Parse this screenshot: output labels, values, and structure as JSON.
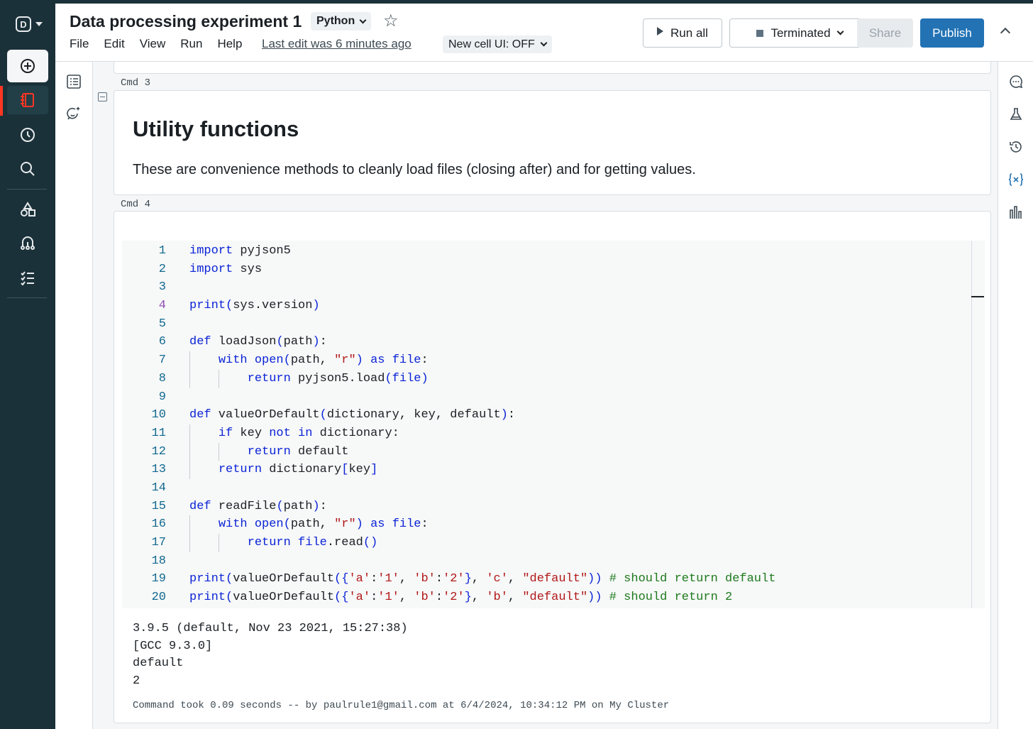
{
  "notebook": {
    "title": "Data processing experiment 1",
    "language": "Python",
    "menu": [
      "File",
      "Edit",
      "View",
      "Run",
      "Help"
    ],
    "last_edit": "Last edit was 6 minutes ago",
    "new_cell_ui": "New cell UI: OFF"
  },
  "toolbar": {
    "run_all": "Run all",
    "cluster_status": "Terminated",
    "share": "Share",
    "publish": "Publish"
  },
  "colors": {
    "rail": "#1b3139",
    "accent": "#ff3621",
    "publish": "#2272b4"
  },
  "icons": {
    "rail": [
      "databricks-logo-icon",
      "new-icon",
      "workspace-icon",
      "recents-icon",
      "search-icon",
      "catalog-icon",
      "workflows-icon",
      "compute-icon"
    ],
    "left_panel": [
      "table-of-contents-icon",
      "assistant-icon"
    ],
    "right_panel": [
      "comments-icon",
      "experiments-icon",
      "revision-history-icon",
      "variables-icon",
      "data-profile-icon"
    ]
  },
  "cells": {
    "cmd3": {
      "label": "Cmd 3",
      "heading": "Utility functions",
      "text": "These are convenience methods to cleanly load files (closing after) and for getting values."
    },
    "cmd4": {
      "label": "Cmd 4",
      "code": [
        "import pyjson5",
        "import sys",
        "",
        "print(sys.version)",
        "",
        "def loadJson(path):",
        "    with open(path, \"r\") as file:",
        "        return pyjson5.load(file)",
        "",
        "def valueOrDefault(dictionary, key, default):",
        "    if key not in dictionary:",
        "        return default",
        "    return dictionary[key]",
        "",
        "def readFile(path):",
        "    with open(path, \"r\") as file:",
        "        return file.read()",
        "",
        "print(valueOrDefault({'a':'1', 'b':'2'}, 'c', \"default\")) # should return default",
        "print(valueOrDefault({'a':'1', 'b':'2'}, 'b', \"default\")) # should return 2"
      ],
      "output": [
        "3.9.5 (default, Nov 23 2021, 15:27:38)",
        "[GCC 9.3.0]",
        "default",
        "2"
      ],
      "command_took": "Command took 0.09 seconds -- by paulrule1@gmail.com at 6/4/2024, 10:34:12 PM on My Cluster"
    }
  }
}
